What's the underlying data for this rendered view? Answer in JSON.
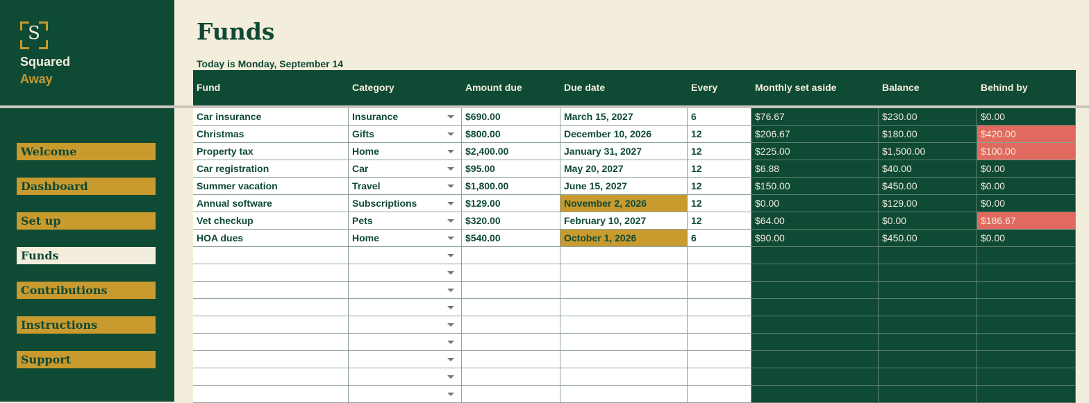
{
  "brand": {
    "logo_letter": "S",
    "line1": "Squared",
    "line2": "Away"
  },
  "nav": [
    "Welcome",
    "Dashboard",
    "Set up",
    "Funds",
    "Contributions",
    "Instructions",
    "Support"
  ],
  "nav_active": "Funds",
  "page": {
    "title": "Funds",
    "today": "Today is Monday, September 14"
  },
  "columns": [
    "Fund",
    "Category",
    "Amount due",
    "Due date",
    "Every",
    "Monthly set aside",
    "Balance",
    "Behind by"
  ],
  "rows": [
    [
      "Car insurance",
      "Insurance",
      "$690.00",
      "March 15, 2027",
      "6",
      "$76.67",
      "$230.00",
      "$0.00"
    ],
    [
      "Christmas",
      "Gifts",
      "$800.00",
      "December 10, 2026",
      "12",
      "$206.67",
      "$180.00",
      "$420.00"
    ],
    [
      "Property tax",
      "Home",
      "$2,400.00",
      "January 31, 2027",
      "12",
      "$225.00",
      "$1,500.00",
      "$100.00"
    ],
    [
      "Car registration",
      "Car",
      "$95.00",
      "May 20, 2027",
      "12",
      "$6.88",
      "$40.00",
      "$0.00"
    ],
    [
      "Summer vacation",
      "Travel",
      "$1,800.00",
      "June 15, 2027",
      "12",
      "$150.00",
      "$450.00",
      "$0.00"
    ],
    [
      "Annual software",
      "Subscriptions",
      "$129.00",
      "November 2, 2026",
      "12",
      "$0.00",
      "$129.00",
      "$0.00"
    ],
    [
      "Vet checkup",
      "Pets",
      "$320.00",
      "February 10, 2027",
      "12",
      "$64.00",
      "$0.00",
      "$186.67"
    ],
    [
      "HOA dues",
      "Home",
      "$540.00",
      "October 1, 2026",
      "6",
      "$90.00",
      "$450.00",
      "$0.00"
    ]
  ],
  "highlight_due_date_rows": [
    5,
    7
  ],
  "behind_alert_rows": [
    1,
    2,
    6
  ],
  "empty_rows": 9,
  "colors": {
    "dark_green": "#0f4a35",
    "gold": "#c99a2e",
    "cream": "#f3eddc",
    "alert_red": "#e06a5f"
  }
}
